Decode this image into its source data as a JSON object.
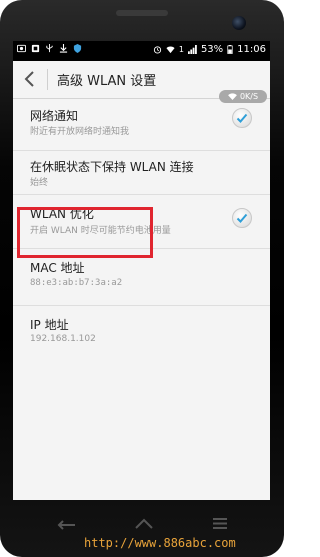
{
  "status_bar": {
    "battery": "53%",
    "time": "11:06",
    "signal": "1"
  },
  "action_bar": {
    "title": "高级 WLAN 设置"
  },
  "speed_indicator": "0K/S",
  "settings": [
    {
      "title": "网络通知",
      "summary": "附近有开放网络时通知我",
      "checked": true
    },
    {
      "title": "在休眠状态下保持 WLAN 连接",
      "summary": "始终",
      "checked": false
    },
    {
      "title": "WLAN 优化",
      "summary": "开启 WLAN 时尽可能节约电池用量",
      "checked": true
    },
    {
      "title": "MAC 地址",
      "summary": "88:e3:ab:b7:3a:a2",
      "checked": false
    },
    {
      "title": "IP 地址",
      "summary": "192.168.1.102",
      "checked": false
    }
  ],
  "watermark": "http://www.886abc.com",
  "colors": {
    "highlight": "#e0252f",
    "check_blue": "#2f9fd8"
  }
}
